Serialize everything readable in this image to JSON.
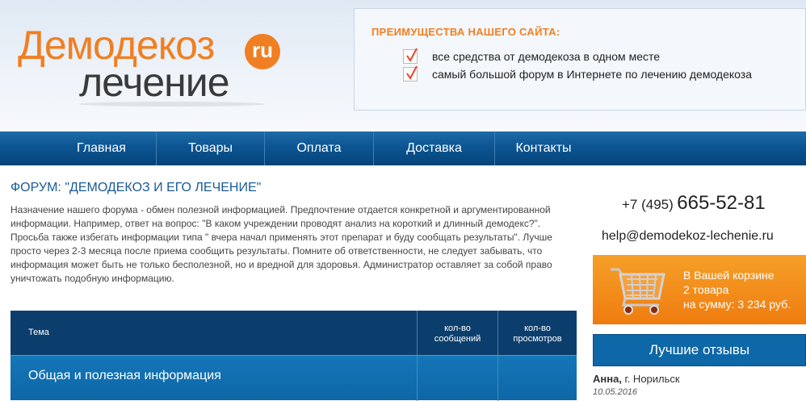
{
  "logo": {
    "top": "Демодекоз",
    "ru": "ru",
    "bottom": "лечение"
  },
  "advantages": {
    "title": "ПРЕИМУЩЕСТВА НАШЕГО САЙТА:",
    "items": [
      "все средства от демодекоза в одном месте",
      "самый большой форум в Интернете по лечению демодекоза"
    ],
    "check_color": "#e8452c"
  },
  "nav": {
    "items": [
      "Главная",
      "Товары",
      "Оплата",
      "Доставка",
      "Контакты"
    ]
  },
  "forum": {
    "title": "ФОРУМ: \"ДЕМОДЕКОЗ И ЕГО ЛЕЧЕНИЕ\"",
    "description": "Назначение нашего форума - обмен полезной информацией. Предпочтение отдается конкретной и аргументированной информации. Например, ответ на вопрос: \"В каком учреждении проводят анализ на короткий и длинный демодекс?\". Просьба также избегать информации типа \" вчера начал применять этот препарат и буду сообщать результаты\". Лучше просто через 2-3 месяца после приема сообщить результаты. Помните об ответственности, не следует забывать, что информация может быть не только бесполезной, но и вредной для здоровья. Администратор оставляет за собой право уничтожать подобную информацию."
  },
  "table": {
    "columns": [
      "Тема",
      "кол-во сообщений",
      "кол-во просмотров"
    ],
    "col2_lines": [
      "кол-во",
      "сообщений"
    ],
    "col3_lines": [
      "кол-во",
      "просмотров"
    ],
    "rows": [
      {
        "topic": "Общая и полезная информация",
        "messages": "",
        "views": ""
      }
    ]
  },
  "contacts": {
    "phone_code": "+7 (495)",
    "phone_number": "665-52-81",
    "email": "help@demodekoz-lechenie.ru"
  },
  "cart": {
    "line1": "В Вашей корзине",
    "line2": "2 товара",
    "line3": "на сумму: 3 234 руб."
  },
  "reviews": {
    "button_label": "Лучшие отзывы",
    "first_name": "Анна,",
    "first_city": " г. Норильск",
    "first_date": "10.05.2016"
  },
  "colors": {
    "brand_orange": "#f07f22",
    "nav_blue": "#0c5592",
    "title_blue": "#1a5a94"
  }
}
